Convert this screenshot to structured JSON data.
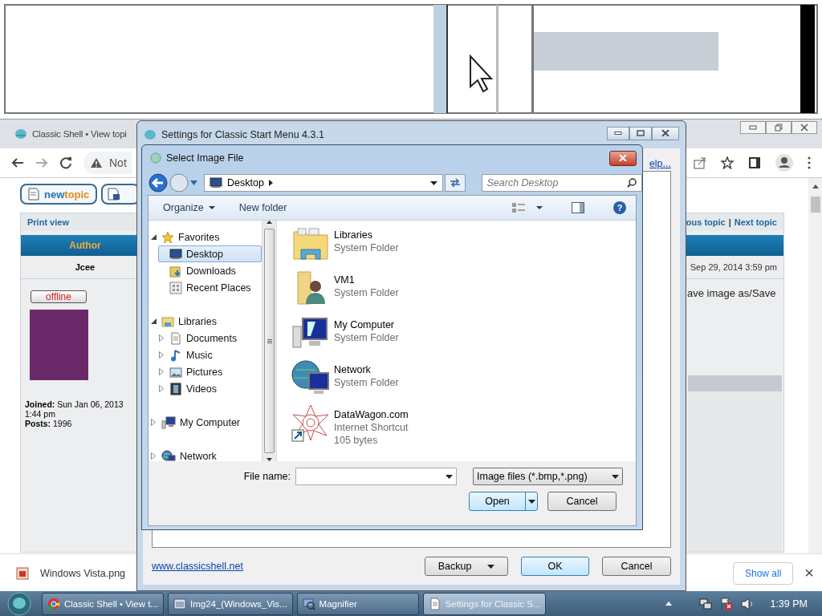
{
  "browser": {
    "tab_title": "Classic Shell • View topi",
    "security_label": "Not",
    "new_topic": {
      "part1": "new",
      "part2": "topic"
    },
    "print_view": "Print view",
    "prev_topic": "ous topic",
    "separator": "|",
    "next_topic": "Next topic",
    "author_header": "Author",
    "author_name": "Jcee",
    "post_date": "Sep 29, 2014 3:59 pm",
    "status_badge": "offline",
    "joined": "**Joined:** Sun Jan 06, 2013 1:44 pm",
    "posts": "**Posts:** 1996",
    "post_text": "ave image as/Save",
    "download": {
      "file": "Windows Vista.png",
      "show_all": "Show all",
      "close": "×"
    }
  },
  "settings_window": {
    "title": "Settings for Classic Start Menu 4.3.1",
    "help_link": "elp...",
    "website": "www.classicshell.net",
    "buttons": [
      {
        "label": "Backup",
        "kind": "split"
      },
      {
        "label": "OK",
        "kind": "default"
      },
      {
        "label": "Cancel",
        "kind": "plain"
      }
    ]
  },
  "dialog": {
    "title": "Select Image File",
    "address": "Desktop",
    "search_placeholder": "Search Desktop",
    "toolbar": [
      "Organize",
      "New folder"
    ],
    "help_icon": "?",
    "nav": [
      {
        "label": "Favorites",
        "kind": "star",
        "expanded": true,
        "selected": false,
        "children": [
          {
            "label": "Desktop",
            "kind": "desktop",
            "selected": true
          },
          {
            "label": "Downloads",
            "kind": "downloads",
            "selected": false
          },
          {
            "label": "Recent Places",
            "kind": "recent",
            "selected": false
          }
        ]
      },
      {
        "label": "Libraries",
        "kind": "library",
        "expanded": true,
        "selected": false,
        "children": [
          {
            "label": "Documents",
            "kind": "document",
            "expanded": false,
            "selected": false
          },
          {
            "label": "Music",
            "kind": "music",
            "expanded": false,
            "selected": false
          },
          {
            "label": "Pictures",
            "kind": "pictures",
            "expanded": false,
            "selected": false
          },
          {
            "label": "Videos",
            "kind": "videos",
            "expanded": false,
            "selected": false
          }
        ]
      },
      {
        "label": "My Computer",
        "kind": "computer",
        "expanded": false,
        "selected": false
      },
      {
        "label": "Network",
        "kind": "network",
        "expanded": false,
        "selected": false
      }
    ],
    "files": [
      {
        "name": "Libraries",
        "details": [
          "System Folder"
        ],
        "kind": "library"
      },
      {
        "name": "VM1",
        "details": [
          "System Folder"
        ],
        "kind": "user"
      },
      {
        "name": "My Computer",
        "details": [
          "System Folder"
        ],
        "kind": "computer"
      },
      {
        "name": "Network",
        "details": [
          "System Folder"
        ],
        "kind": "network"
      },
      {
        "name": "DataWagon.com",
        "details": [
          "Internet Shortcut",
          "105 bytes"
        ],
        "kind": "shortcut"
      }
    ],
    "file_name_label": "File name:",
    "file_type": "Image files (*.bmp,*.png)",
    "open": "Open",
    "cancel": "Cancel"
  },
  "taskbar": {
    "items": [
      {
        "label": "Classic Shell • View t...",
        "kind": "browser",
        "selected": false
      },
      {
        "label": "Img24_(Windows_Vis...",
        "kind": "picture",
        "selected": false
      },
      {
        "label": "Magnifier",
        "kind": "magnifier",
        "selected": false
      },
      {
        "label": "Settings for Classic S...",
        "kind": "document",
        "selected": true
      }
    ],
    "clock": "1:39 PM"
  }
}
